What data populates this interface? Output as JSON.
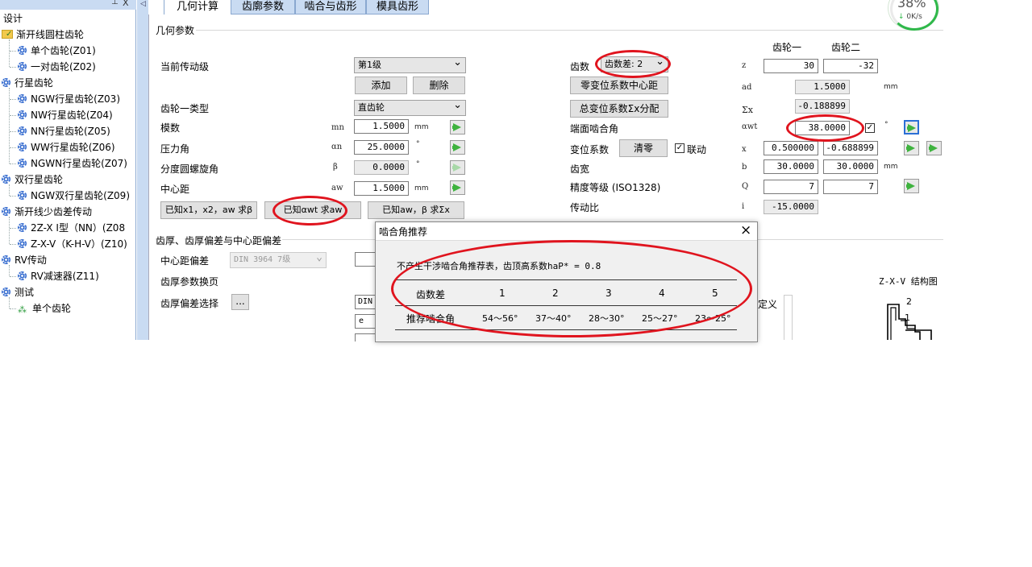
{
  "tree": {
    "root": "设计",
    "items": [
      {
        "label": "渐开线圆柱齿轮",
        "level": 0
      },
      {
        "label": "单个齿轮(Z01)",
        "level": 1
      },
      {
        "label": "一对齿轮(Z02)",
        "level": 1
      },
      {
        "label": "行星齿轮",
        "level": 0
      },
      {
        "label": "NGW行星齿轮(Z03)",
        "level": 1
      },
      {
        "label": "NW行星齿轮(Z04)",
        "level": 1
      },
      {
        "label": "NN行星齿轮(Z05)",
        "level": 1
      },
      {
        "label": "WW行星齿轮(Z06)",
        "level": 1
      },
      {
        "label": "NGWN行星齿轮(Z07)",
        "level": 1
      },
      {
        "label": "双行星齿轮",
        "level": 0
      },
      {
        "label": "NGW双行星齿轮(Z09)",
        "level": 1
      },
      {
        "label": "渐开线少齿差传动",
        "level": 0
      },
      {
        "label": "2Z-X Ⅰ型（NN）(Z08",
        "level": 1
      },
      {
        "label": "Z-X-V（K-H-V）(Z10)",
        "level": 1
      },
      {
        "label": "RV传动",
        "level": 0
      },
      {
        "label": "RV减速器(Z11)",
        "level": 1
      },
      {
        "label": "测试",
        "level": 0
      },
      {
        "label": "单个齿轮",
        "level": 1
      }
    ]
  },
  "tabs": [
    "几何计算",
    "齿廓参数",
    "啮合与齿形",
    "模具齿形"
  ],
  "net": {
    "percent": "38%",
    "speed": "0K/s"
  },
  "geom": {
    "group_title": "几何参数",
    "stage_label": "当前传动级",
    "stage_value": "第1级",
    "add_btn": "添加",
    "del_btn": "删除",
    "gear_type_label": "齿轮一类型",
    "gear_type_value": "直齿轮",
    "module_label": "模数",
    "module_sym": "mn",
    "module_val": "1.5000",
    "module_unit": "mm",
    "pressure_label": "压力角",
    "pressure_sym": "αn",
    "pressure_val": "25.0000",
    "pressure_unit": "°",
    "helix_label": "分度圆螺旋角",
    "helix_sym": "β",
    "helix_val": "0.0000",
    "helix_unit": "°",
    "center_label": "中心距",
    "center_sym": "aw",
    "center_val": "1.5000",
    "center_unit": "mm",
    "btn_known1": "已知x1，x2，aw 求β",
    "btn_known2": "已知αwt 求aw",
    "btn_known3": "已知aw，β 求Σx",
    "gear1_header": "齿轮一",
    "gear2_header": "齿轮二",
    "teeth_label": "齿数",
    "teeth_diff": "齿数差: 2",
    "z_sym": "z",
    "z1": "30",
    "z2": "-32",
    "zero_shift_btn": "零变位系数中心距",
    "ad_sym": "ad",
    "ad_val": "1.5000",
    "ad_unit": "mm",
    "total_shift_btn": "总变位系数Σx分配",
    "sx_sym": "Σx",
    "sx_val": "-0.188899",
    "awt_label": "端面啮合角",
    "awt_sym": "αwt",
    "awt_val": "38.0000",
    "awt_unit": "°",
    "shift_label": "变位系数",
    "clear_btn": "清零",
    "link_label": "联动",
    "x_sym": "x",
    "x1": "0.500000",
    "x2": "-0.688899",
    "width_label": "齿宽",
    "b_sym": "b",
    "b1": "30.0000",
    "b2": "30.0000",
    "b_unit": "mm",
    "precision_label": "精度等级 (ISO1328)",
    "q_sym": "Q",
    "q1": "7",
    "q2": "7",
    "ratio_label": "传动比",
    "i_sym": "i",
    "i_val": "-15.0000"
  },
  "thickness": {
    "group_title": "齿厚、齿厚偏差与中心距偏差",
    "center_dev_label": "中心距偏差",
    "center_dev_value": "DIN 3964 7级",
    "param_page_label": "齿厚参数换页",
    "dev_select_label": "齿厚偏差选择",
    "ellipsis_btn": "...",
    "din_partial": "DIN",
    "e_partial": "e",
    "define_partial": "定义",
    "diagram_title": "Z-X-V 结构图",
    "diagram_num2": "2",
    "diagram_num1": "1"
  },
  "dialog": {
    "title": "啮合角推荐",
    "description": "不产生干涉啮合角推荐表，齿顶高系数haP* = 0.8",
    "header_label": "齿数差",
    "columns": [
      "1",
      "2",
      "3",
      "4",
      "5"
    ],
    "row_label": "推荐啮合角",
    "values": [
      "54～56°",
      "37～40°",
      "28～30°",
      "25～27°",
      "23～25°"
    ]
  }
}
